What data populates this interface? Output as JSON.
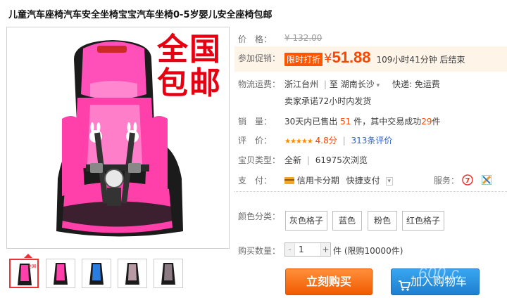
{
  "title": "儿童汽车座椅汽车安全坐椅宝宝汽车坐椅0-5岁婴儿安全座椅包邮",
  "promo_overlay": [
    "全国",
    "包邮"
  ],
  "price": {
    "label": "价　格：",
    "original": "¥ 132.00"
  },
  "promotion": {
    "label": "参加促销：",
    "badge": "限时打折",
    "currency": "¥",
    "price": "51.88",
    "countdown": "109小时41分钟 后结束"
  },
  "shipping": {
    "label": "物流运费：",
    "from": "浙江台州",
    "separator": "至",
    "to": "湖南长沙",
    "express": "快递: 免运费",
    "promise": "卖家承诺72小时内发货"
  },
  "sales": {
    "label": "销　量：",
    "prefix": "30天内已售出",
    "sold": "51",
    "middle": "件，其中交易成功",
    "success": "29",
    "suffix": "件"
  },
  "rating": {
    "label": "评　价：",
    "stars": "★★★★★",
    "score": "4.8分",
    "reviews": "313条评价"
  },
  "item_type": {
    "label": "宝贝类型：",
    "condition": "全新",
    "views": "61975次浏览"
  },
  "payment": {
    "label": "支　付：",
    "method1": "信用卡分期",
    "method2": "快捷支付",
    "service_label": "服务："
  },
  "colors": {
    "label": "颜色分类：",
    "options": [
      "灰色格子",
      "蓝色",
      "粉色",
      "红色格子"
    ]
  },
  "quantity": {
    "label": "购买数量：",
    "value": "1",
    "unit": "件",
    "limit": "(限购10000件)"
  },
  "buttons": {
    "buy": "立刻购买",
    "cart": "加入购物车"
  },
  "watermark": "600.c",
  "theme": {
    "accent": "#ff4400",
    "buy": "#f05a00",
    "cart": "#1e7fd0",
    "promo": "#e60012"
  }
}
